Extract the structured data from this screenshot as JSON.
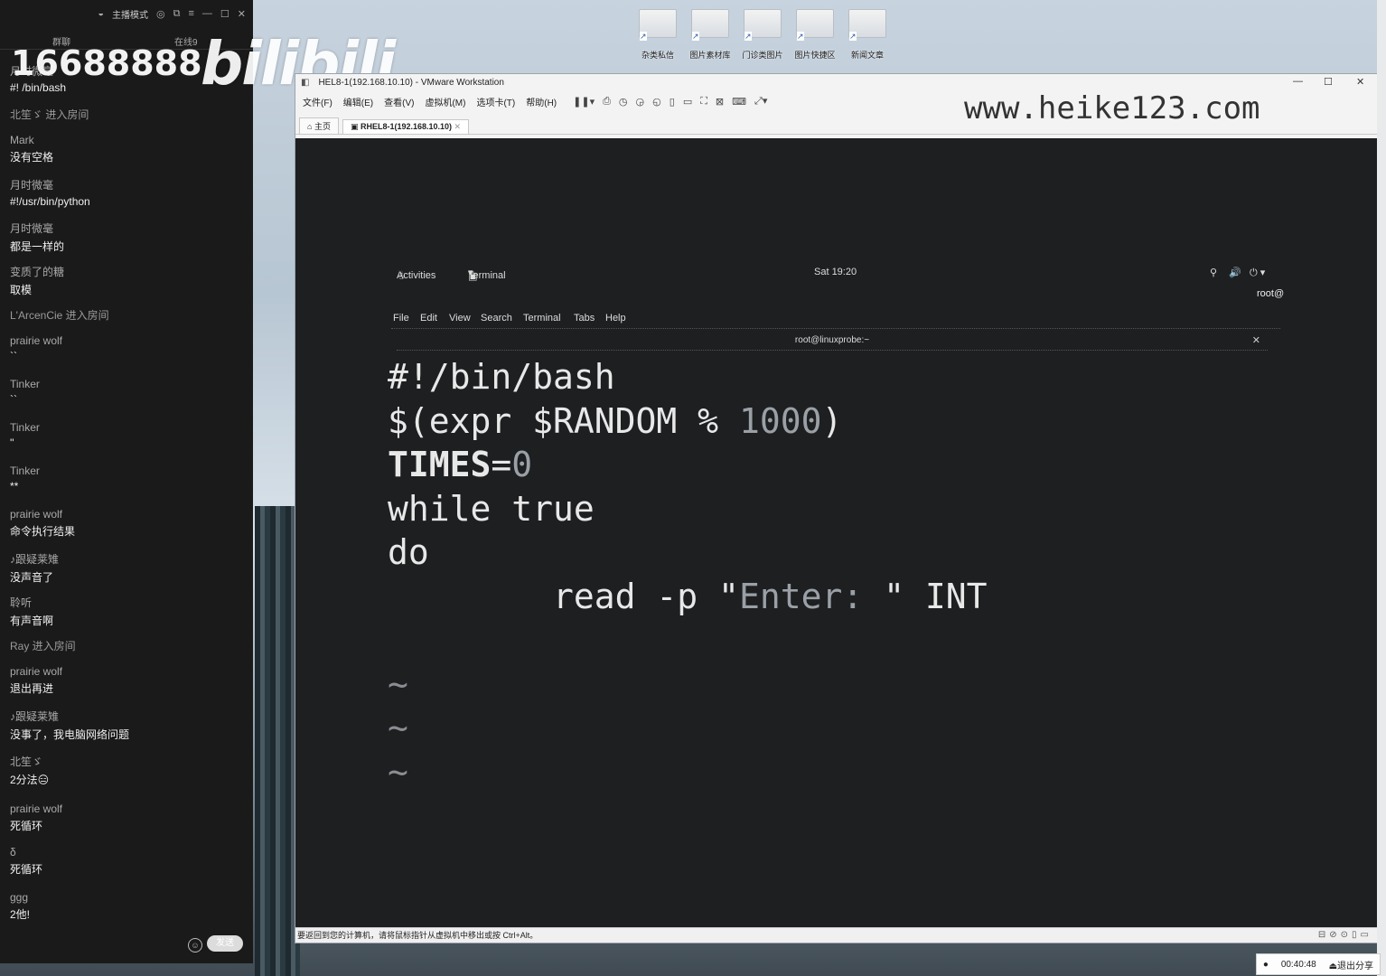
{
  "desktop": {
    "icons": [
      {
        "label": "杂类私信",
        "icon": "folder-shortcut-icon"
      },
      {
        "label": "图片素材库",
        "icon": "folder-shortcut-icon"
      },
      {
        "label": "门诊类图片",
        "icon": "folder-shortcut-icon"
      },
      {
        "label": "图片快捷区",
        "icon": "folder-shortcut-icon"
      },
      {
        "label": "新闻文章",
        "icon": "folder-shortcut-icon"
      }
    ]
  },
  "chat": {
    "mode_label": "主播模式",
    "tabs": {
      "left": "群聊",
      "right": "在线9"
    },
    "watermark_number": "16688888",
    "watermark_brand": "bilibili",
    "messages": [
      {
        "user": "月时微毫",
        "text": "#! /bin/bash"
      },
      {
        "user": "北笙ゞ 进入房间",
        "text": ""
      },
      {
        "user": "Mark",
        "text": "没有空格"
      },
      {
        "user": "月时微毫",
        "text": "#!/usr/bin/python"
      },
      {
        "user": "月时微毫",
        "text": "都是一样的"
      },
      {
        "user": "变质了的糖",
        "text": "取模"
      },
      {
        "user": "L'ArcenCie 进入房间",
        "text": ""
      },
      {
        "user": "prairie wolf",
        "text": "``"
      },
      {
        "user": "Tinker",
        "text": "``"
      },
      {
        "user": "Tinker",
        "text": "''"
      },
      {
        "user": "Tinker",
        "text": "**"
      },
      {
        "user": "prairie wolf",
        "text": "命令执行结果"
      },
      {
        "user": "♪跟疑莱雉",
        "text": "没声音了"
      },
      {
        "user": "聆听",
        "text": "有声音啊"
      },
      {
        "user": "Ray 进入房间",
        "text": ""
      },
      {
        "user": "prairie wolf",
        "text": "退出再进"
      },
      {
        "user": "♪跟疑莱雉",
        "text": "没事了，我电脑网络问题"
      },
      {
        "user": "北笙ゞ",
        "text": "2分法😑"
      },
      {
        "user": "prairie wolf",
        "text": "死循环"
      },
      {
        "user": "δ",
        "text": "死循环"
      },
      {
        "user": "ggg",
        "text": "2他!"
      }
    ],
    "send_label": "发送"
  },
  "vmware": {
    "title": "HEL8-1(192.168.10.10) - VMware Workstation",
    "menu": [
      "文件(F)",
      "编辑(E)",
      "查看(V)",
      "虚拟机(M)",
      "选项卡(T)",
      "帮助(H)"
    ],
    "watermark_site": "www.heike123.com",
    "tabs": [
      {
        "label": "主页"
      },
      {
        "label": "RHEL8-1(192.168.10.10)"
      }
    ],
    "status_text": "要返回到您的计算机，请将鼠标指针从虚拟机中移出或按 Ctrl+Alt。"
  },
  "gnome": {
    "activities": "Activities",
    "app_menu": "Terminal",
    "clock": "Sat 19:20",
    "user_tag": "root@"
  },
  "terminal": {
    "menu": [
      "File",
      "Edit",
      "View",
      "Search",
      "Terminal",
      "Tabs",
      "Help"
    ],
    "title": "root@linuxprobe:~",
    "lines": {
      "l1": "#!/bin/bash",
      "l2a": "$(expr $RANDOM % ",
      "l2b": "1000",
      "l2c": ")",
      "l3a": "TIMES",
      "l3b": "=",
      "l3c": "0",
      "l4": "while true",
      "l5": "do",
      "l6a": "        read -p \"",
      "l6b": "Enter: ",
      "l6c": "\" INT",
      "tilde": "~"
    }
  },
  "share": {
    "timer": "00:40:48",
    "exit_label": "退出分享"
  }
}
